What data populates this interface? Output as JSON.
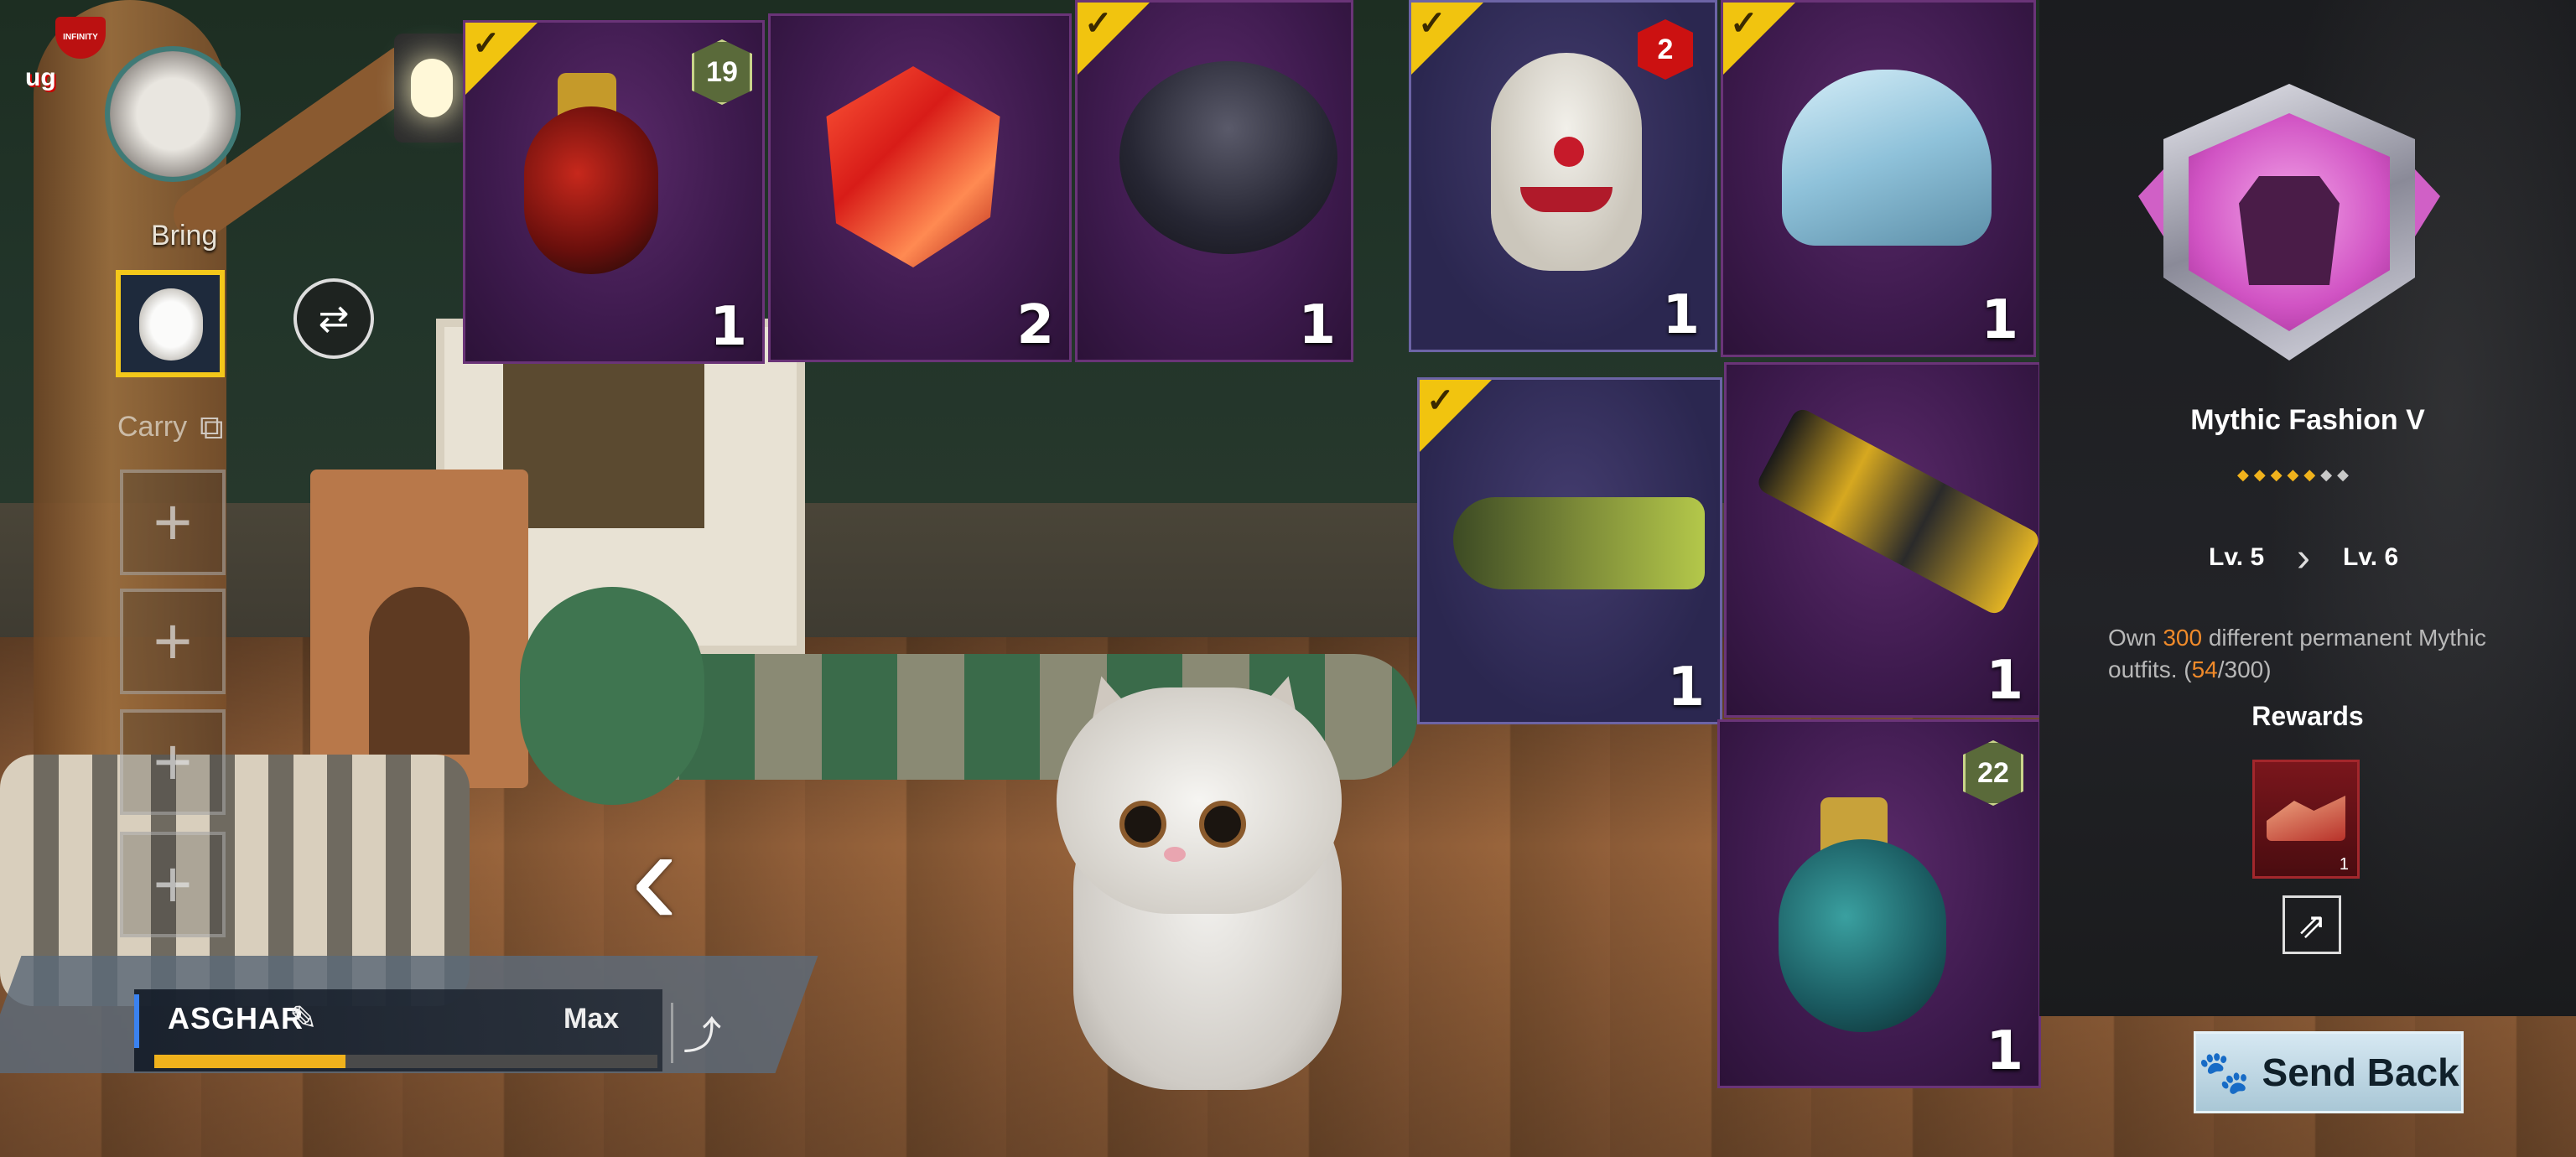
{
  "logo": {
    "badge_text": "INFINITY",
    "text": "ug"
  },
  "pet_panel": {
    "bring_label": "Bring",
    "carry_label": "Carry",
    "add_slot_symbol": "+",
    "pet_name": "ASGHAR",
    "level_text": "Max",
    "progress": 0.38
  },
  "items": [
    {
      "name": "red-grenade",
      "quantity": "1",
      "badge": "19",
      "checked": true
    },
    {
      "name": "red-gem",
      "quantity": "2",
      "badge": "",
      "checked": false
    },
    {
      "name": "parachute",
      "quantity": "1",
      "badge": "",
      "checked": true
    },
    {
      "name": "clown-mask",
      "quantity": "1",
      "badge": "2",
      "checked": true
    },
    {
      "name": "ice-helmet",
      "quantity": "1",
      "badge": "",
      "checked": true
    },
    {
      "name": "helicopter",
      "quantity": "1",
      "badge": "",
      "checked": true
    },
    {
      "name": "gold-gun",
      "quantity": "1",
      "badge": "",
      "checked": false
    },
    {
      "name": "teal-grenade",
      "quantity": "1",
      "badge": "22",
      "checked": false
    }
  ],
  "achievement": {
    "title": "Mythic Fashion V",
    "stars_filled": 5,
    "stars_total": 7,
    "level_from": "Lv. 5",
    "level_to": "Lv. 6",
    "desc_prefix": "Own ",
    "desc_target": "300",
    "desc_middle": " different permanent Mythic outfits. (",
    "desc_progress": "54",
    "desc_suffix": "/300)",
    "rewards_label": "Rewards",
    "reward_quantity": "1"
  },
  "send_back_label": "Send Back",
  "colors": {
    "accent_gold": "#f1c40f",
    "progress": "#f0b21c",
    "highlight": "#f08a2a",
    "medal": "#d154c4"
  }
}
